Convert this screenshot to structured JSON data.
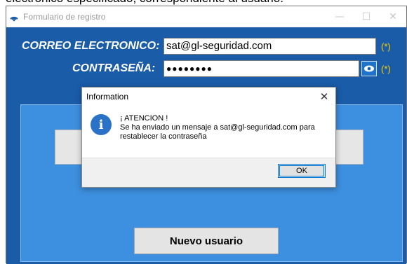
{
  "background_text": "electrónico especificado, correspondiente al usuario.",
  "window": {
    "title": "Formulario de registro",
    "minimize_symbol": "—",
    "maximize_symbol": "☐",
    "close_symbol": "✕"
  },
  "form": {
    "email_label": "CORREO ELECTRONICO:",
    "email_value": "sat@gl-seguridad.com",
    "email_required": "(*)",
    "password_label": "CONTRASEÑA:",
    "password_value": "●●●●●●●●",
    "password_required": "(*)",
    "new_user_button": "Nuevo usuario"
  },
  "dialog": {
    "title": "Information",
    "close_symbol": "✕",
    "icon_glyph": "i",
    "message_line1": "¡ ATENCION !",
    "message_line2": "Se ha enviado un mensaje a sat@gl-seguridad.com para restablecer la contraseña",
    "ok_label": "OK"
  },
  "colors": {
    "form_background": "#1a5ca8",
    "panel_background": "#3d8fdf",
    "required_marker": "#ffd200",
    "info_icon": "#2a72c8"
  }
}
